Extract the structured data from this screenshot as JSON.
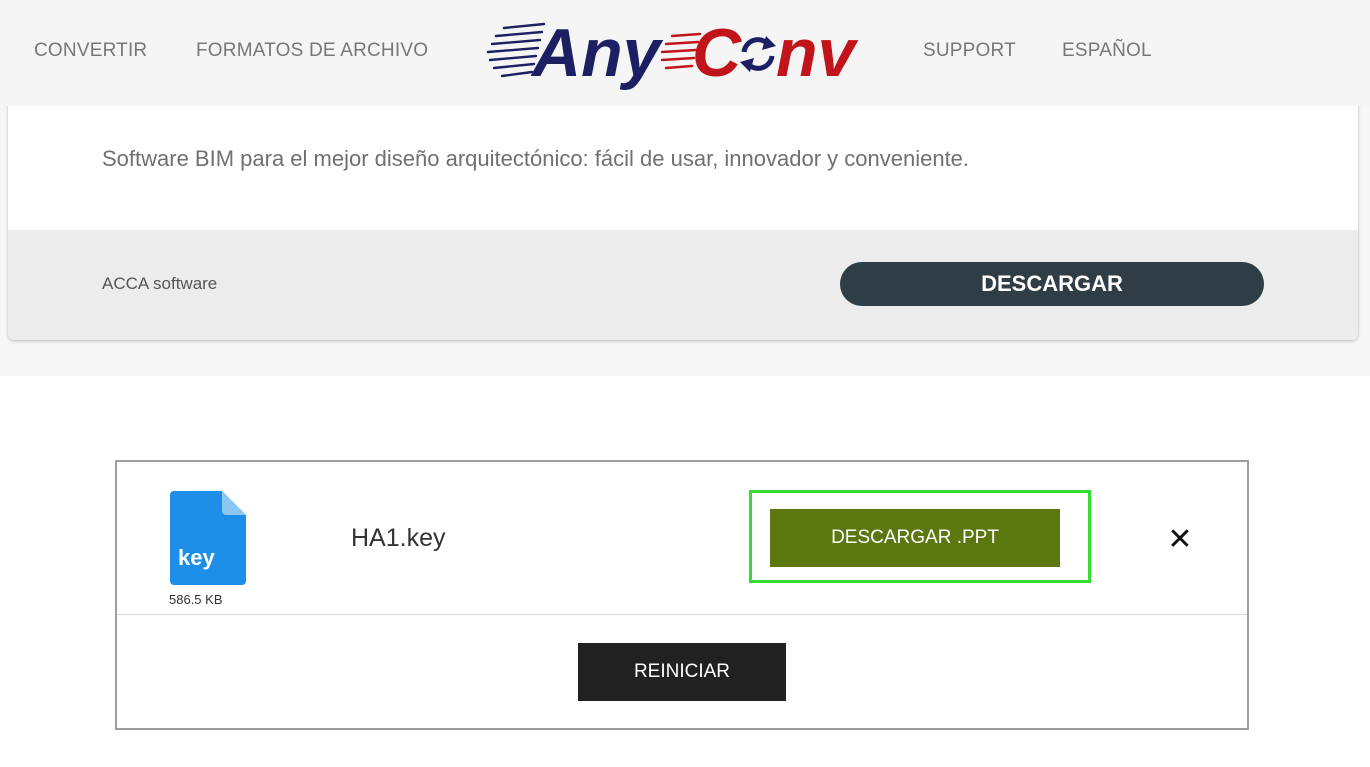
{
  "header": {
    "nav_left": [
      "CONVERTIR",
      "FORMATOS DE ARCHIVO"
    ],
    "nav_right": [
      "SUPPORT",
      "ESPAÑOL"
    ],
    "logo": {
      "part1": "Any",
      "part2_c": "C",
      "part2_rest": "nv",
      "icon": "refresh-arrows-icon",
      "colors": {
        "navy": "#1c2063",
        "red": "#c0141a"
      }
    }
  },
  "ad": {
    "description": "Software BIM para el mejor diseño arquitectónico: fácil de usar, innovador y conveniente.",
    "brand": "ACCA software",
    "button_label": "DESCARGAR"
  },
  "converter": {
    "file_icon": "key-file-icon",
    "file_icon_label": "key",
    "file_size": "586.5 KB",
    "file_name": "HA1.key",
    "download_label": "DESCARGAR .PPT",
    "close_icon": "close-icon",
    "close_glyph": "✕",
    "restart_label": "REINICIAR",
    "colors": {
      "download": "#5d7710",
      "highlight": "#33dd33",
      "restart": "#212121",
      "file_icon": "#1e8fe8"
    }
  }
}
